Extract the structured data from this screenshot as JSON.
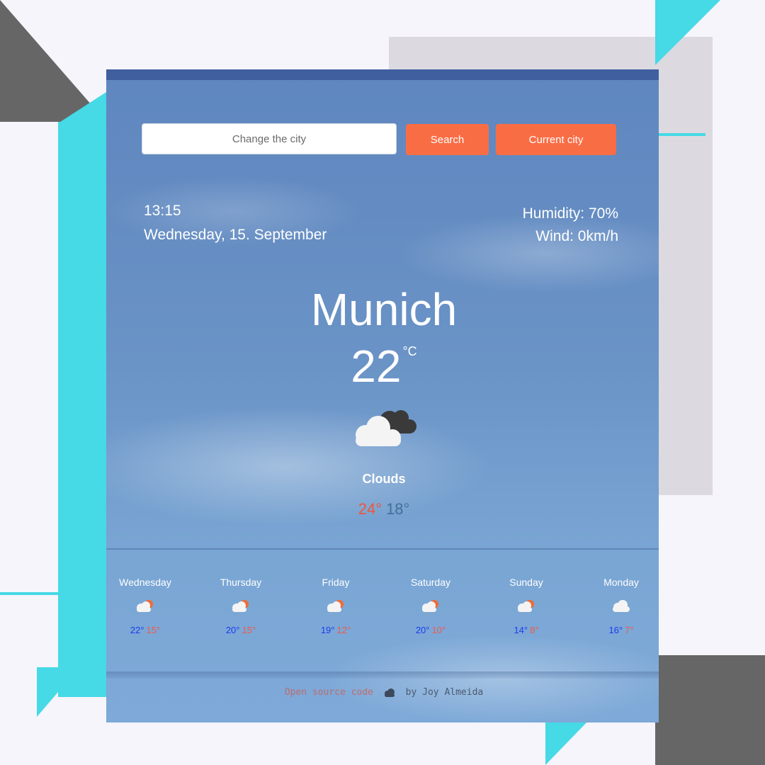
{
  "search": {
    "placeholder": "Change the city",
    "search_label": "Search",
    "current_label": "Current city"
  },
  "info": {
    "time": "13:15",
    "date": "Wednesday, 15. September",
    "humidity": "Humidity: 70%",
    "wind": "Wind: 0km/h"
  },
  "current": {
    "city": "Munich",
    "temp": "22",
    "unit": "°C",
    "icon": "clouds-icon",
    "description": "Clouds",
    "max": "24°",
    "min": "18°"
  },
  "forecast": [
    {
      "day": "Wednesday",
      "max": "22°",
      "min": "15°",
      "icon": "sun-cloud-rain-icon"
    },
    {
      "day": "Thursday",
      "max": "20°",
      "min": "15°",
      "icon": "sun-cloud-rain-icon"
    },
    {
      "day": "Friday",
      "max": "19°",
      "min": "12°",
      "icon": "sun-cloud-rain-icon"
    },
    {
      "day": "Saturday",
      "max": "20°",
      "min": "10°",
      "icon": "sun-cloud-rain-icon"
    },
    {
      "day": "Sunday",
      "max": "14°",
      "min": "8°",
      "icon": "sun-cloud-rain-icon"
    },
    {
      "day": "Monday",
      "max": "16°",
      "min": "7°",
      "icon": "cloud-icon"
    }
  ],
  "footer": {
    "link_text": "Open source code",
    "suffix": "by Joy Almeida"
  },
  "colors": {
    "button": "#f96d45",
    "max_temp_main": "#f0553a",
    "min_temp_main": "#3f6f9a",
    "forecast_max": "#1a3cf0",
    "forecast_min": "#f05a4a",
    "accent_cyan": "#46d9e6"
  }
}
